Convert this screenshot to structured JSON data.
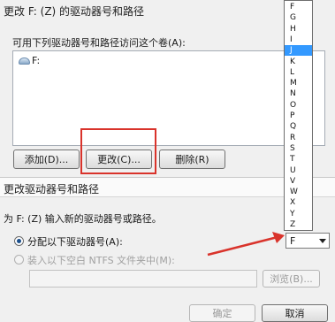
{
  "back_dialog": {
    "title": "更改 F: (Z) 的驱动器号和路径",
    "description": "可用下列驱动器号和路径访问这个卷(A):",
    "drive_entry": "F:",
    "buttons": {
      "add": "添加(D)...",
      "change": "更改(C)...",
      "delete": "删除(R)"
    }
  },
  "front_dialog": {
    "title": "更改驱动器号和路径",
    "description": "为 F: (Z) 输入新的驱动器号或路径。",
    "option_assign": "分配以下驱动器号(A):",
    "option_folder": "装入以下空白 NTFS 文件夹中(M):",
    "folder_path": "",
    "browse_label": "浏览(B)...",
    "selected_letter": "F",
    "ok_label": "确定",
    "cancel_label": "取消"
  },
  "letter_list": {
    "letters": [
      "F",
      "G",
      "H",
      "I",
      "J",
      "K",
      "L",
      "M",
      "N",
      "O",
      "P",
      "Q",
      "R",
      "S",
      "T",
      "U",
      "V",
      "W",
      "X",
      "Y",
      "Z"
    ],
    "selected": "J"
  },
  "colors": {
    "highlight": "#d9332b",
    "selection": "#3399ff"
  }
}
